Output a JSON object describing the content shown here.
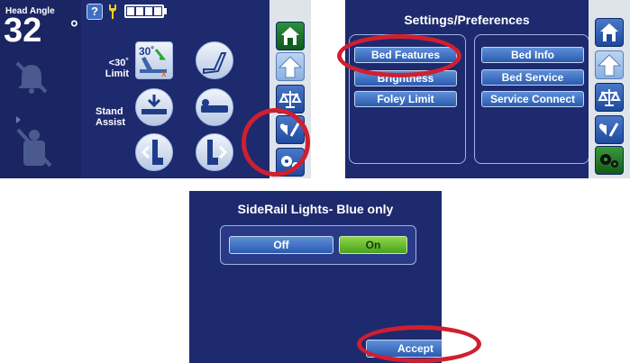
{
  "panel1": {
    "head_angle_label": "Head Angle",
    "head_angle_value": "32",
    "degree_symbol": "°",
    "help_label": "?",
    "limit_label_line1": "<30˚",
    "limit_label_line2": "Limit",
    "stand_label_line1": "Stand",
    "stand_label_line2": "Assist",
    "tile_30_label": "30˚"
  },
  "panel2": {
    "title": "Settings/Preferences",
    "left_buttons": [
      "Bed Features",
      "Brightness",
      "Foley Limit"
    ],
    "right_buttons": [
      "Bed Info",
      "Bed Service",
      "Service Connect"
    ]
  },
  "panel3": {
    "title": "SideRail Lights- Blue only",
    "off_label": "Off",
    "on_label": "On",
    "accept_label": "Accept"
  },
  "colors": {
    "screen_bg": "#1e2a6e",
    "highlight_ring": "#d01f2f",
    "on_green": "#5eb82a",
    "off_blue": "#3d6fc4"
  }
}
